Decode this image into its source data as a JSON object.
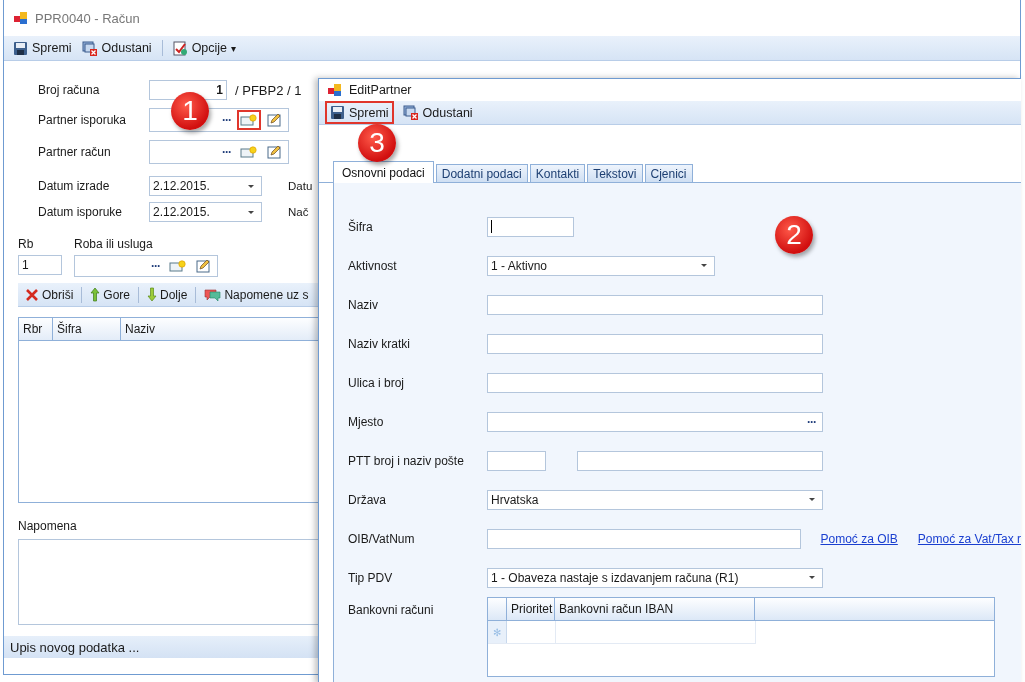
{
  "main_window": {
    "title": "PPR0040 - Račun",
    "toolbar": [
      {
        "kind": "save",
        "label": "Spremi"
      },
      {
        "kind": "cancel",
        "label": "Odustani"
      },
      {
        "kind": "options",
        "label": "Opcije",
        "dropdown": "▾"
      }
    ],
    "invoice_number": {
      "label": "Broj računa",
      "value": "1",
      "suffix": "/ PFBP2 / 1"
    },
    "partners": [
      {
        "label": "Partner isporuka",
        "dots": "···",
        "highlighted": true
      },
      {
        "label": "Partner račun",
        "dots": "···",
        "highlighted": false
      }
    ],
    "dates": [
      {
        "label": "Datum izrade",
        "value": "2.12.2015.",
        "side_label": "Datu"
      },
      {
        "label": "Datum isporuke",
        "value": "2.12.2015.",
        "side_label": "Nač"
      }
    ],
    "item": {
      "rb_label": "Rb",
      "rb_value": "1",
      "goods_label": "Roba ili usluga",
      "dots": "···"
    },
    "items_toolbar": [
      {
        "kind": "delete",
        "label": "Obriši"
      },
      {
        "kind": "up",
        "label": "Gore"
      },
      {
        "kind": "down",
        "label": "Dolje"
      },
      {
        "kind": "notes",
        "label": "Napomene uz s"
      }
    ],
    "grid_columns": [
      "Rbr",
      "Šifra",
      "Naziv"
    ],
    "note_label": "Napomena",
    "status_bar": "Upis novog podatka ..."
  },
  "dialog": {
    "title": "EditPartner",
    "toolbar": [
      {
        "kind": "save",
        "label": "Spremi",
        "highlighted": true
      },
      {
        "kind": "cancel",
        "label": "Odustani",
        "highlighted": false
      }
    ],
    "tabs": [
      {
        "label": "Osnovni podaci",
        "selected": true
      },
      {
        "label": "Dodatni podaci",
        "selected": false
      },
      {
        "label": "Kontakti",
        "selected": false
      },
      {
        "label": "Tekstovi",
        "selected": false
      },
      {
        "label": "Cjenici",
        "selected": false
      }
    ],
    "fields": [
      {
        "kind": "code",
        "label": "Šifra"
      },
      {
        "kind": "combo",
        "label": "Aktivnost",
        "value": "1 - Aktivno"
      },
      {
        "kind": "text",
        "label": "Naziv"
      },
      {
        "kind": "text",
        "label": "Naziv kratki"
      },
      {
        "kind": "text",
        "label": "Ulica i broj"
      },
      {
        "kind": "lookup",
        "label": "Mjesto",
        "dots": "···"
      },
      {
        "kind": "double",
        "label": "PTT broj i naziv pošte"
      },
      {
        "kind": "combo_wide",
        "label": "Država",
        "value": "Hrvatska"
      },
      {
        "kind": "text_links",
        "label": "OIB/VatNum",
        "links": [
          "Pomoć za OIB",
          "Pomoć za Vat/Tax r"
        ]
      },
      {
        "kind": "combo_wide",
        "label": "Tip PDV",
        "value": "1 - Obaveza nastaje s izdavanjem računa (R1)"
      },
      {
        "kind": "grid",
        "label": "Bankovni računi",
        "columns": [
          "Prioritet",
          "Bankovni račun IBAN"
        ],
        "new_row_mark": "✻"
      }
    ]
  },
  "callouts": [
    {
      "label": "1"
    },
    {
      "label": "2"
    },
    {
      "label": "3"
    }
  ]
}
